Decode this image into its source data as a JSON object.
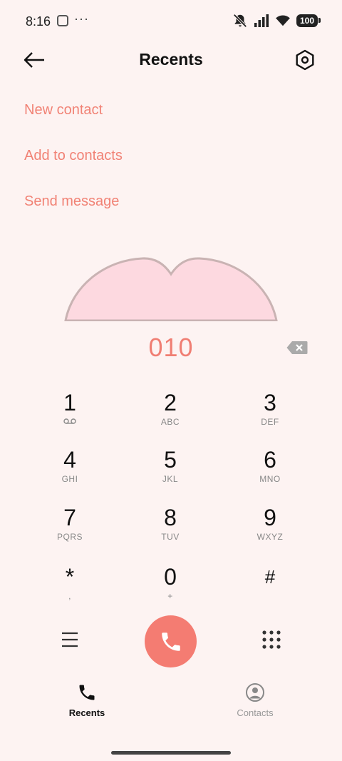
{
  "status_bar": {
    "time": "8:16",
    "overflow": "···",
    "battery": "100"
  },
  "header": {
    "title": "Recents"
  },
  "actions": {
    "new_contact": "New contact",
    "add_to_contacts": "Add to contacts",
    "send_message": "Send message"
  },
  "dialer": {
    "number": "010",
    "keys": [
      {
        "digit": "1",
        "letters": ""
      },
      {
        "digit": "2",
        "letters": "ABC"
      },
      {
        "digit": "3",
        "letters": "DEF"
      },
      {
        "digit": "4",
        "letters": "GHI"
      },
      {
        "digit": "5",
        "letters": "JKL"
      },
      {
        "digit": "6",
        "letters": "MNO"
      },
      {
        "digit": "7",
        "letters": "PQRS"
      },
      {
        "digit": "8",
        "letters": "TUV"
      },
      {
        "digit": "9",
        "letters": "WXYZ"
      },
      {
        "digit": "*",
        "letters": ","
      },
      {
        "digit": "0",
        "letters": "+"
      },
      {
        "digit": "#",
        "letters": ""
      }
    ]
  },
  "bottom_nav": {
    "recents": "Recents",
    "contacts": "Contacts"
  },
  "colors": {
    "accent": "#F18275",
    "call_button": "#F47C72",
    "background": "#FDF3F2",
    "heart_fill": "#FDD9E0"
  },
  "icons": [
    "back-arrow-icon",
    "settings-hexagon-icon",
    "backspace-icon",
    "voicemail-icon",
    "menu-icon",
    "phone-icon",
    "dialpad-icon",
    "contacts-person-icon",
    "silent-bell-icon",
    "signal-icon",
    "wifi-icon"
  ]
}
